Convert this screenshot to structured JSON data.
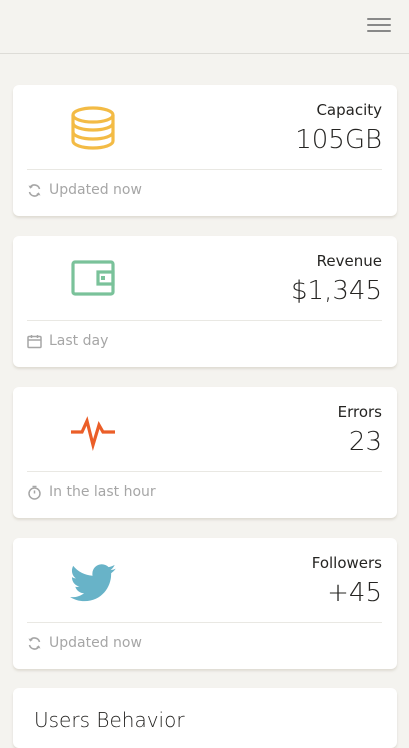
{
  "topbar": {
    "menu_icon": "hamburger-menu-icon"
  },
  "colors": {
    "capacity_accent": "#f3bb45",
    "revenue_accent": "#7ac29a",
    "errors_accent": "#eb5e28",
    "followers_accent": "#68b3c8",
    "muted_text": "#a6a6a6",
    "background": "#f4f3ef"
  },
  "cards": [
    {
      "label": "Capacity",
      "value": "105GB",
      "icon": "database-icon",
      "footer_icon": "refresh-icon",
      "footer_text": "Updated now"
    },
    {
      "label": "Revenue",
      "value": "$1,345",
      "icon": "wallet-icon",
      "footer_icon": "calendar-icon",
      "footer_text": "Last day"
    },
    {
      "label": "Errors",
      "value": "23",
      "icon": "pulse-icon",
      "footer_icon": "timer-icon",
      "footer_text": "In the last hour"
    },
    {
      "label": "Followers",
      "value": "+45",
      "icon": "twitter-icon",
      "footer_icon": "refresh-icon",
      "footer_text": "Updated now"
    }
  ],
  "users_behavior": {
    "title": "Users Behavior"
  }
}
